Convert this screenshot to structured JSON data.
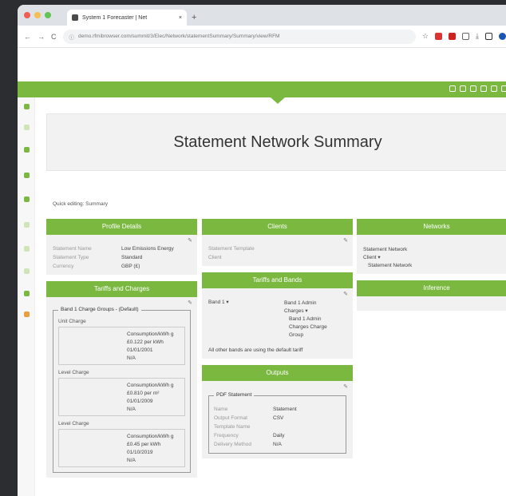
{
  "browser": {
    "tab_title": "System 1 Forecaster | Net",
    "url": "demo.rfmibrowser.com/summit/3/Elec/Network/statementSummary/Summary/view/RFM",
    "new_tab": "+",
    "nav_back": "←",
    "nav_forward": "→",
    "reload": "C",
    "info": "ⓘ"
  },
  "page": {
    "title": "Statement Network Summary",
    "quick_edit": "Quick editing: Summary"
  },
  "edit_glyph": "✎",
  "profile": {
    "header": "Profile Details",
    "rows": [
      {
        "k": "Statement Name",
        "v": "Low Emissions Energy"
      },
      {
        "k": "Statement Type",
        "v": "Standard"
      },
      {
        "k": "Currency",
        "v": "GBP (£)"
      }
    ]
  },
  "tariffs": {
    "header": "Tariffs and Charges",
    "band_title": "Band 1 Charge Groups - (Default)",
    "groups": [
      {
        "name": "Unit Charge",
        "lines": [
          "Consumption/kWh g",
          "£0.122 per kWh",
          "01/01/2001",
          "N/A"
        ]
      },
      {
        "name": "Level Charge",
        "lines": [
          "Consumption/kWh g",
          "£0.810 per m²",
          "01/01/2009",
          "N/A"
        ]
      },
      {
        "name": "Level Charge",
        "lines": [
          "Consumption/kWh g",
          "£0.45 per kWh",
          "01/10/2019",
          "N/A"
        ]
      }
    ]
  },
  "clients": {
    "header": "Clients",
    "rows": [
      {
        "k": "Statement Template",
        "v": ""
      },
      {
        "k": "Client",
        "v": ""
      }
    ]
  },
  "tariffs_bands": {
    "header": "Tariffs and Bands",
    "left": "Band 1 ▾",
    "items": [
      "Band 1 Admin",
      "Charges ▾",
      "Band 1 Admin",
      "Charges Charge",
      "Group"
    ],
    "note": "All other bands are using the default tariff"
  },
  "outputs": {
    "header": "Outputs",
    "legend": "PDF Statement",
    "rows": [
      {
        "k": "Name",
        "v": "Statement"
      },
      {
        "k": "Output Format",
        "v": "CSV"
      },
      {
        "k": "Template Name",
        "v": ""
      },
      {
        "k": "Frequency",
        "v": "Daily"
      },
      {
        "k": "Delivery Method",
        "v": "N/A"
      }
    ]
  },
  "networks": {
    "header": "Networks",
    "lines": [
      "Statement Network",
      "Client ▾",
      "Statement Network"
    ]
  },
  "inference": {
    "header": "Inference"
  }
}
